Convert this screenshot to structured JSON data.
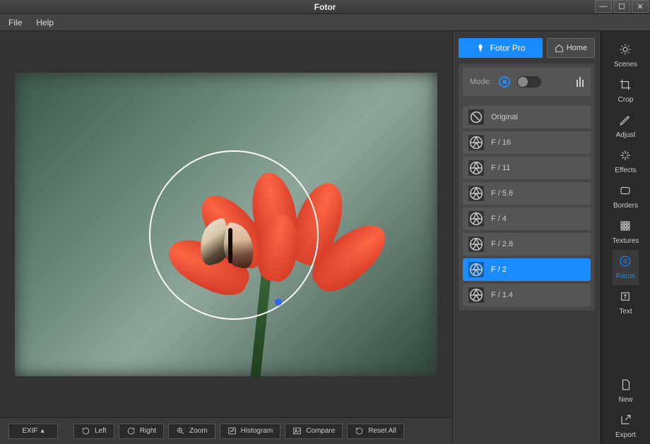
{
  "app": {
    "title": "Fotor"
  },
  "menu": {
    "file": "File",
    "help": "Help"
  },
  "topButtons": {
    "pro": "Fotor Pro",
    "home": "Home"
  },
  "modeRow": {
    "label": "Mode:"
  },
  "fstops": [
    {
      "label": "Original",
      "active": false,
      "icon": "original"
    },
    {
      "label": "F / 16",
      "active": false,
      "icon": "aperture"
    },
    {
      "label": "F / 11",
      "active": false,
      "icon": "aperture"
    },
    {
      "label": "F / 5.6",
      "active": false,
      "icon": "aperture"
    },
    {
      "label": "F / 4",
      "active": false,
      "icon": "aperture"
    },
    {
      "label": "F / 2.8",
      "active": false,
      "icon": "aperture"
    },
    {
      "label": "F / 2",
      "active": true,
      "icon": "aperture"
    },
    {
      "label": "F / 1.4",
      "active": false,
      "icon": "aperture"
    }
  ],
  "sidebar": [
    {
      "label": "Scenes",
      "icon": "sun",
      "active": false
    },
    {
      "label": "Crop",
      "icon": "crop",
      "active": false
    },
    {
      "label": "Adjust",
      "icon": "pencil",
      "active": false
    },
    {
      "label": "Effects",
      "icon": "sparkle",
      "active": false
    },
    {
      "label": "Borders",
      "icon": "border",
      "active": false
    },
    {
      "label": "Textures",
      "icon": "texture",
      "active": false
    },
    {
      "label": "Focus",
      "icon": "target",
      "active": true
    },
    {
      "label": "Text",
      "icon": "text",
      "active": false
    }
  ],
  "sidebarBottom": [
    {
      "label": "New",
      "icon": "file"
    },
    {
      "label": "Export",
      "icon": "export"
    }
  ],
  "bottomBar": {
    "exif": "EXIF",
    "left": "Left",
    "right": "Right",
    "zoom": "Zoom",
    "histogram": "Histogram",
    "compare": "Compare",
    "reset": "Reset All"
  }
}
